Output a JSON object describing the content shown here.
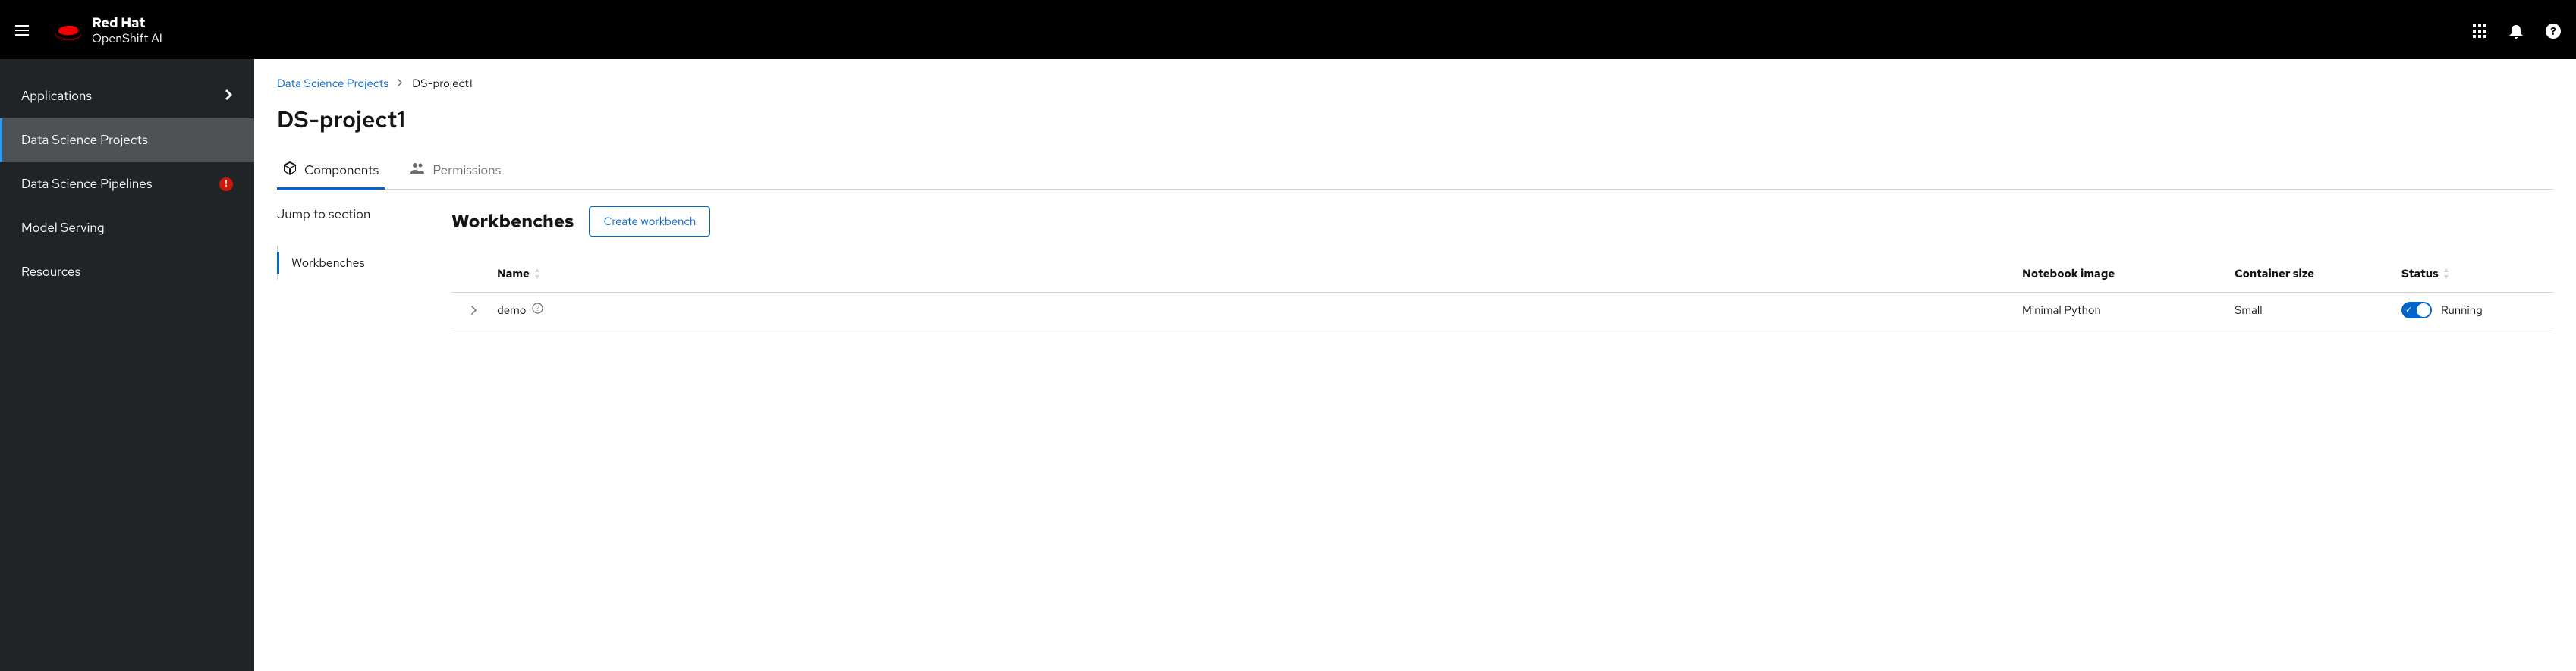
{
  "brand": {
    "name": "Red Hat",
    "product": "OpenShift AI"
  },
  "sidebar": {
    "items": [
      {
        "label": "Applications",
        "has_chevron": true
      },
      {
        "label": "Data Science Projects",
        "active": true
      },
      {
        "label": "Data Science Pipelines",
        "has_badge": true,
        "badge_text": "!"
      },
      {
        "label": "Model Serving"
      },
      {
        "label": "Resources"
      }
    ]
  },
  "breadcrumb": {
    "link": "Data Science Projects",
    "current": "DS-project1"
  },
  "page_title": "DS-project1",
  "tabs": [
    {
      "label": "Components",
      "active": true
    },
    {
      "label": "Permissions"
    }
  ],
  "jump": {
    "title": "Jump to section",
    "items": [
      {
        "label": "Workbenches",
        "active": true
      }
    ]
  },
  "workbenches": {
    "title": "Workbenches",
    "create_button": "Create workbench",
    "columns": {
      "name": "Name",
      "image": "Notebook image",
      "size": "Container size",
      "status": "Status"
    },
    "rows": [
      {
        "name": "demo",
        "image": "Minimal Python",
        "size": "Small",
        "status": "Running",
        "running": true
      }
    ]
  }
}
